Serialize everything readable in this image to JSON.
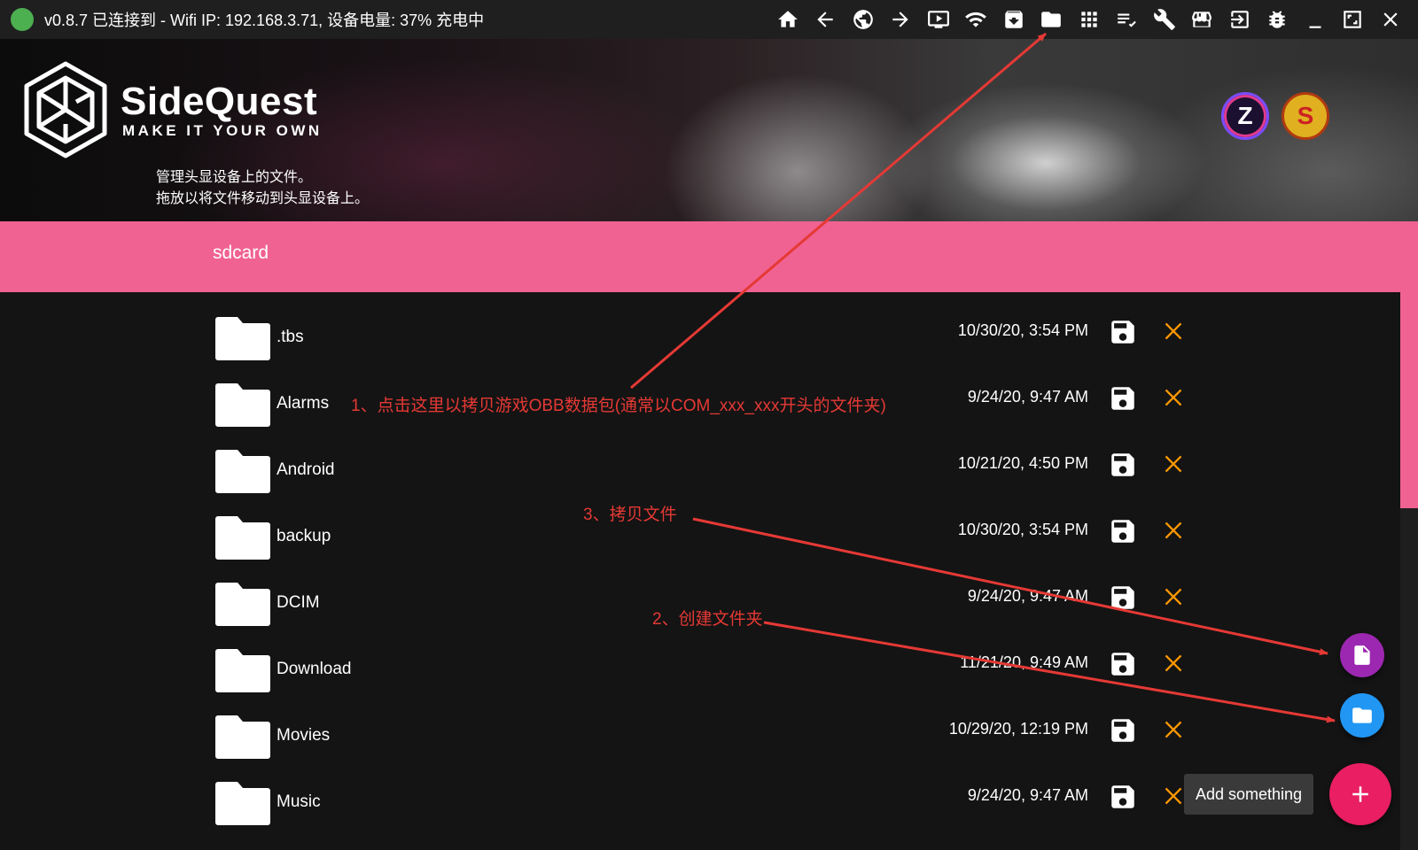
{
  "titlebar": {
    "status_text": "v0.8.7  已连接到 - Wifi IP: 192.168.3.71, 设备电量: 37% 充电中",
    "status_color": "#4caf50",
    "toolbar_icons": [
      "home-icon",
      "back-icon",
      "globe-icon",
      "forward-icon",
      "tv-play-icon",
      "wifi-icon",
      "download-box-icon",
      "folder-icon",
      "apps-grid-icon",
      "checklist-icon",
      "wrench-icon",
      "store-icon",
      "exit-icon",
      "bug-icon",
      "minimize-icon",
      "maximize-icon",
      "close-icon"
    ]
  },
  "header": {
    "brand_name": "SideQuest",
    "tagline": "MAKE IT YOUR OWN",
    "description_line1": "管理头显设备上的文件。",
    "description_line2": "拖放以将文件移动到头显设备上。",
    "avatars": [
      "Z",
      "S"
    ]
  },
  "path": {
    "current": "sdcard",
    "accent_color": "#f06292"
  },
  "files": [
    {
      "name": ".tbs",
      "date": "10/30/20, 3:54 PM"
    },
    {
      "name": "Alarms",
      "date": "9/24/20, 9:47 AM"
    },
    {
      "name": "Android",
      "date": "10/21/20, 4:50 PM"
    },
    {
      "name": "backup",
      "date": "10/30/20, 3:54 PM"
    },
    {
      "name": "DCIM",
      "date": "9/24/20, 9:47 AM"
    },
    {
      "name": "Download",
      "date": "11/21/20, 9:49 AM"
    },
    {
      "name": "Movies",
      "date": "10/29/20, 12:19 PM"
    },
    {
      "name": "Music",
      "date": "9/24/20, 9:47 AM"
    }
  ],
  "annotations": {
    "step1": "1、点击这里以拷贝游戏OBB数据包(通常以COM_xxx_xxx开头的文件夹)",
    "step2": "2、创建文件夹",
    "step3": "3、拷贝文件",
    "color": "#e53935"
  },
  "fab": {
    "tooltip": "Add something",
    "add_color": "#e91e63",
    "file_color": "#9c27b0",
    "folder_color": "#2196f3"
  }
}
